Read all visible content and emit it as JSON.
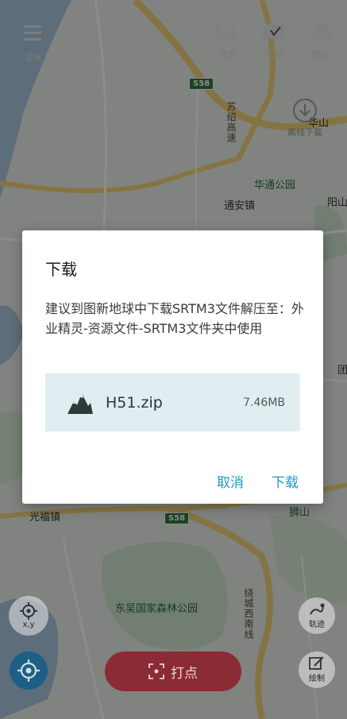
{
  "map": {
    "labels": [
      "华通公园",
      "通安镇",
      "阳山",
      "东吴国家森林公园",
      "光福镇",
      "狮山",
      "华山",
      "团"
    ],
    "road_shields": [
      "S58",
      "S58"
    ],
    "road_names": [
      "苏绍高速",
      "绕城西南线"
    ]
  },
  "toolbar": {
    "menu_label": "菜单",
    "search_label": "搜索",
    "data_label": "数据",
    "layers_label": "图层",
    "offline_label": "离线下载"
  },
  "buttons": {
    "xy_label": "x,y",
    "track_label": "轨迹",
    "draw_label": "绘制",
    "dot_label": "打点"
  },
  "dialog": {
    "title": "下载",
    "message": "建议到图新地球中下载SRTM3文件解压至：外业精灵-资源文件-SRTM3文件夹中使用",
    "file": {
      "name": "H51.zip",
      "size": "7.46MB",
      "icon": "mountain-icon"
    },
    "cancel_label": "取消",
    "download_label": "下载"
  },
  "colors": {
    "accent": "#1b9bc9",
    "dot_button": "#8b2b35",
    "locate_button": "#1d5f86",
    "file_row": "#e0eef2"
  }
}
